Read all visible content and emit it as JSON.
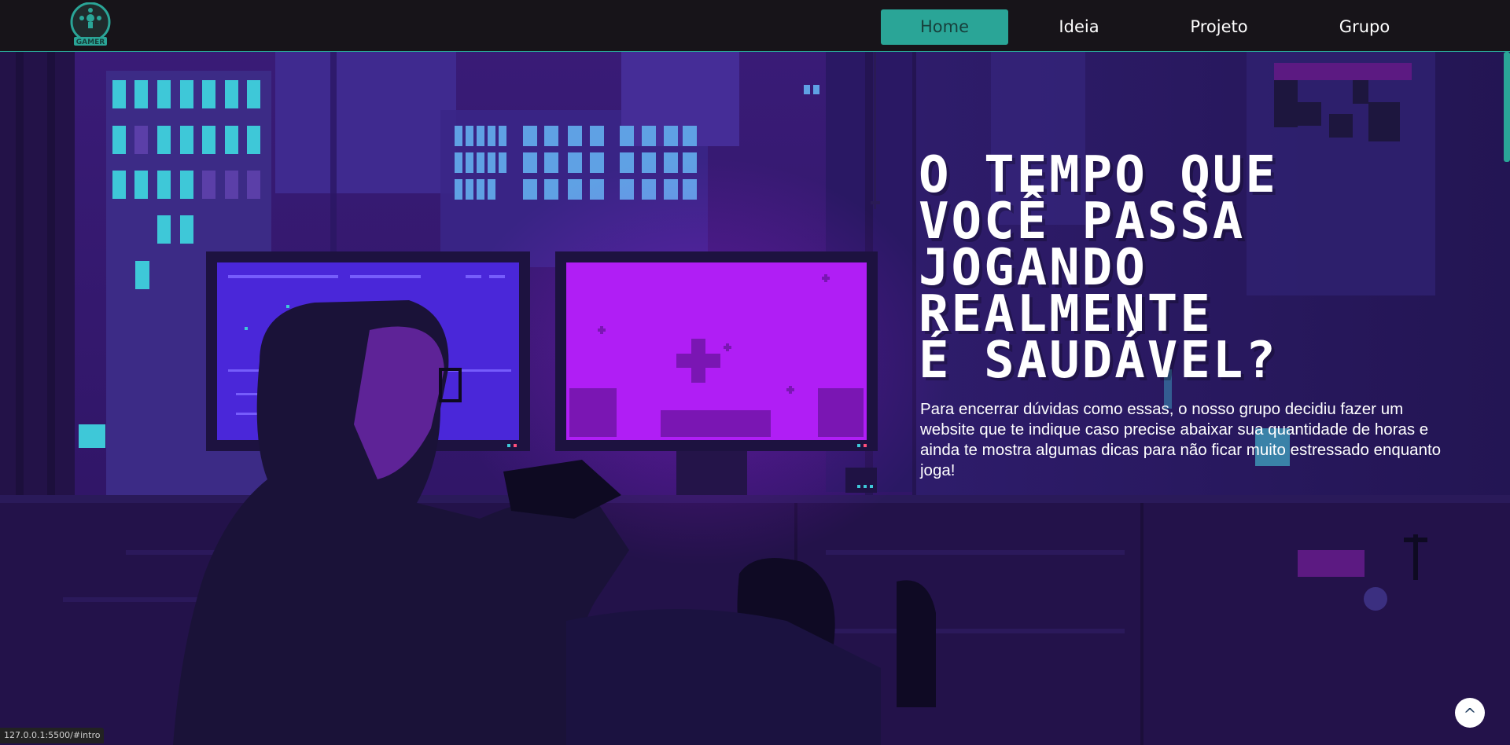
{
  "logo": {
    "text": "GAMER",
    "icon": "gamepad-icon"
  },
  "nav": {
    "items": [
      {
        "label": "Home",
        "active": true
      },
      {
        "label": "Ideia",
        "active": false
      },
      {
        "label": "Projeto",
        "active": false
      },
      {
        "label": "Grupo",
        "active": false
      }
    ]
  },
  "hero": {
    "title": "O TEMPO QUE\nVOCÊ PASSA\nJOGANDO\nREALMENTE\nÉ SAUDÁVEL?",
    "description": "Para encerrar dúvidas como essas, o nosso grupo decidiu fazer um website que te indique caso precise abaixar sua quantidade de horas e ainda te mostra algumas dicas para não ficar muito estressado enquanto joga!"
  },
  "scroll_top": {
    "icon": "caret-up-icon",
    "glyph": "^"
  },
  "status_bar": {
    "url": "127.0.0.1:5500/#intro"
  },
  "colors": {
    "accent": "#2aa597",
    "navbar": "#171419",
    "scene_base": "#2a1456",
    "screen_magenta": "#b01ef5"
  }
}
